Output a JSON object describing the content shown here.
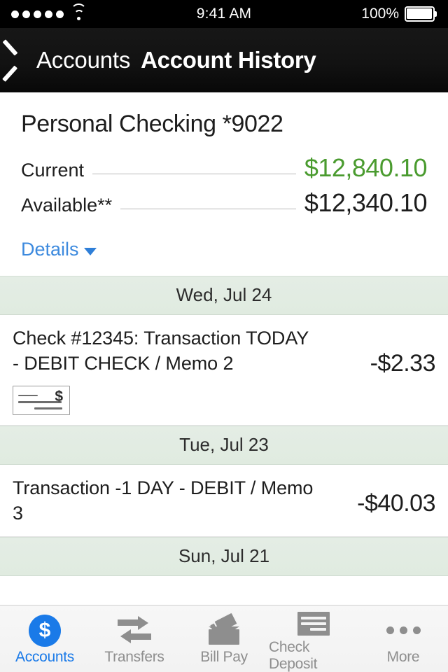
{
  "status_bar": {
    "signal_dots": 5,
    "wifi_icon": "wifi-icon",
    "time": "9:41 AM",
    "battery_percent": "100%",
    "battery_icon": "battery-full-icon"
  },
  "nav": {
    "back_icon": "chevron-left-icon",
    "back_label": "Accounts",
    "title": "Account History"
  },
  "summary": {
    "account_name": "Personal Checking *9022",
    "rows": [
      {
        "label": "Current",
        "amount": "$12,840.10",
        "color": "#4a9b2f"
      },
      {
        "label": "Available**",
        "amount": "$12,340.10",
        "color": "#1d1d1d"
      }
    ],
    "details_label": "Details",
    "details_caret_icon": "caret-down-icon",
    "details_color": "#3d8ade"
  },
  "transactions": {
    "sections": [
      {
        "date": "Wed, Jul 24",
        "items": [
          {
            "description": "Check #12345: Transaction TODAY - DEBIT CHECK / Memo 2",
            "amount": "-$2.33",
            "has_check_image": true,
            "check_icon": "check-image-icon",
            "check_dollar_glyph": "$"
          }
        ]
      },
      {
        "date": "Tue, Jul 23",
        "items": [
          {
            "description": "Transaction -1 DAY - DEBIT / Memo 3",
            "amount": "-$40.03",
            "has_check_image": false
          }
        ]
      },
      {
        "date": "Sun, Jul 21",
        "items": []
      }
    ]
  },
  "tabbar": {
    "items": [
      {
        "label": "Accounts",
        "icon": "dollar-circle-icon",
        "active": true
      },
      {
        "label": "Transfers",
        "icon": "transfer-arrows-icon",
        "active": false
      },
      {
        "label": "Bill Pay",
        "icon": "envelope-card-icon",
        "active": false
      },
      {
        "label": "Check Deposit",
        "icon": "check-lines-icon",
        "active": false
      },
      {
        "label": "More",
        "icon": "ellipsis-icon",
        "active": false
      }
    ],
    "active_color": "#1a7ae8",
    "inactive_color": "#8e8e8e"
  }
}
